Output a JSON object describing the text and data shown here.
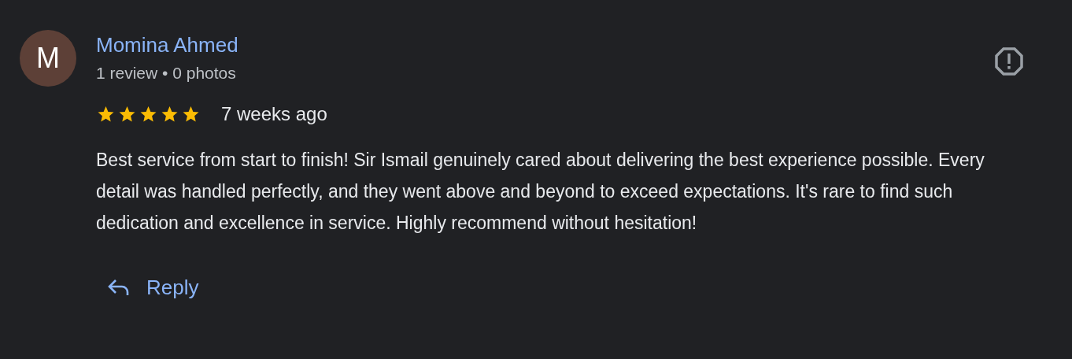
{
  "review": {
    "avatar_letter": "M",
    "author": "Momina Ahmed",
    "author_stats": "1 review • 0 photos",
    "stars": 5,
    "time": "7 weeks ago",
    "text": "Best service from start to finish! Sir Ismail genuinely cared about delivering the best experience possible. Every detail was handled perfectly, and they went above and beyond to exceed expectations. It's rare to find such dedication and excellence in service. Highly recommend without hesitation!",
    "reply_label": "Reply"
  }
}
